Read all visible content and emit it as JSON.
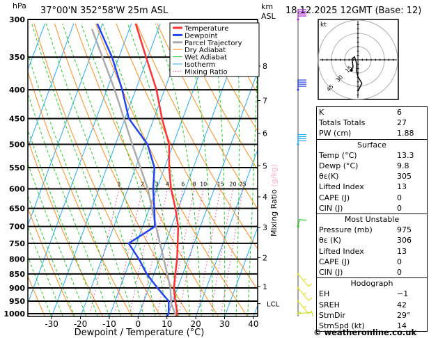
{
  "header": {
    "pressure_unit": "hPa",
    "location": "37°00'N  352°58'W  25m  ASL",
    "km_label": "km",
    "asl_label": "ASL",
    "datetime": "18.12.2025  12GMT  (Base: 12)"
  },
  "chart_data": {
    "type": "skew-t",
    "xlabel": "Dewpoint / Temperature (°C)",
    "ylabel_right_a": "Mixing Ratio",
    "ylabel_right_b": "(g/kg)",
    "xlim": [
      -40,
      40
    ],
    "ylim_hpa": [
      1013,
      300
    ],
    "x_ticks": [
      -30,
      -20,
      -10,
      0,
      10,
      20,
      30,
      40
    ],
    "pressure_levels": [
      300,
      350,
      400,
      450,
      500,
      550,
      600,
      650,
      700,
      750,
      800,
      850,
      900,
      950,
      1000
    ],
    "km_ticks": [
      {
        "km": 1,
        "p": 895
      },
      {
        "km": 2,
        "p": 795
      },
      {
        "km": 3,
        "p": 703
      },
      {
        "km": 4,
        "p": 620
      },
      {
        "km": 5,
        "p": 546
      },
      {
        "km": 6,
        "p": 478
      },
      {
        "km": 7,
        "p": 418
      },
      {
        "km": 8,
        "p": 363
      }
    ],
    "lcl": {
      "label": "LCL",
      "p": 960
    },
    "mixing_ratio_labels": [
      1,
      2,
      3,
      4,
      6,
      8,
      10,
      15,
      20,
      25
    ],
    "legend": [
      {
        "name": "Temperature",
        "color": "#ff3333",
        "width": 3
      },
      {
        "name": "Dewpoint",
        "color": "#2244ee",
        "width": 3
      },
      {
        "name": "Parcel Trajectory",
        "color": "#aaaaaa",
        "width": 3
      },
      {
        "name": "Dry Adiabat",
        "color": "#ff8c1a",
        "width": 1
      },
      {
        "name": "Wet Adiabat",
        "color": "#22cc22",
        "width": 1
      },
      {
        "name": "Isotherm",
        "color": "#22aaff",
        "width": 1
      },
      {
        "name": "Mixing Ratio",
        "color": "#ff3399",
        "width": 1,
        "dotted": true
      }
    ],
    "temperature": {
      "p": [
        1013,
        1000,
        950,
        900,
        850,
        800,
        750,
        700,
        650,
        600,
        550,
        500,
        450,
        400,
        350,
        300
      ],
      "t": [
        13.3,
        13.2,
        10.9,
        8.7,
        7.4,
        6.1,
        4.3,
        2.3,
        -1.0,
        -5.0,
        -8.4,
        -11.4,
        -17.2,
        -22.8,
        -30.6,
        -39.5
      ]
    },
    "dewpoint": {
      "p": [
        1013,
        1000,
        950,
        900,
        850,
        800,
        750,
        700,
        650,
        600,
        550,
        500,
        450,
        400,
        350,
        300
      ],
      "t": [
        9.8,
        10.2,
        8.6,
        3.0,
        -2.5,
        -7.1,
        -12.7,
        -5.8,
        -8.3,
        -11.2,
        -13.5,
        -18.9,
        -28.7,
        -34.7,
        -42.4,
        -53.0
      ]
    },
    "parcel": {
      "p": [
        1013,
        960,
        900,
        800,
        700,
        600,
        500,
        400,
        312
      ],
      "t": [
        13.3,
        9.8,
        7.5,
        1.5,
        -5.4,
        -13.1,
        -24.2,
        -37.3,
        -53.0
      ]
    },
    "wind_barbs": [
      {
        "p": 300,
        "color": "#aa22cc"
      },
      {
        "p": 400,
        "color": "#2244ee"
      },
      {
        "p": 500,
        "color": "#22aaff"
      },
      {
        "p": 700,
        "color": "#22cc22"
      },
      {
        "p": 850,
        "color": "#e8e030"
      },
      {
        "p": 900,
        "color": "#e8e030"
      },
      {
        "p": 950,
        "color": "#e8e030"
      },
      {
        "p": 1000,
        "color": "#c8e030"
      }
    ],
    "hodograph": {
      "unit_label": "kt",
      "rings_kt": [
        15,
        30,
        45
      ],
      "ring_labels": [
        "15",
        "30",
        "45"
      ],
      "trace_uv": [
        [
          0,
          -35.5
        ],
        [
          4.5,
          -26.8
        ],
        [
          0,
          -19
        ],
        [
          -1.6,
          -12.4
        ],
        [
          -1.3,
          -4.5
        ],
        [
          -3.9,
          3.4
        ],
        [
          -6.6,
          1.3
        ],
        [
          -5.5,
          -8.4
        ],
        [
          -7.4,
          -11.8
        ]
      ]
    }
  },
  "indices": {
    "top": [
      {
        "label": "K",
        "value": "6"
      },
      {
        "label": "Totals Totals",
        "value": "27"
      },
      {
        "label": "PW (cm)",
        "value": "1.88"
      }
    ],
    "surface": {
      "title": "Surface",
      "rows": [
        {
          "label": "Temp (°C)",
          "value": "13.3"
        },
        {
          "label": "Dewp (°C)",
          "value": "9.8"
        },
        {
          "label": "θε(K)",
          "value": "305"
        },
        {
          "label": "Lifted Index",
          "value": "13"
        },
        {
          "label": "CAPE (J)",
          "value": "0"
        },
        {
          "label": "CIN (J)",
          "value": "0"
        }
      ]
    },
    "most_unstable": {
      "title": "Most Unstable",
      "rows": [
        {
          "label": "Pressure (mb)",
          "value": "975"
        },
        {
          "label": "θε (K)",
          "value": "306"
        },
        {
          "label": "Lifted Index",
          "value": "13"
        },
        {
          "label": "CAPE (J)",
          "value": "0"
        },
        {
          "label": "CIN (J)",
          "value": "0"
        }
      ]
    },
    "hodograph": {
      "title": "Hodograph",
      "rows": [
        {
          "label": "EH",
          "value": "−1"
        },
        {
          "label": "SREH",
          "value": "42"
        },
        {
          "label": "StmDir",
          "value": "29°"
        },
        {
          "label": "StmSpd (kt)",
          "value": "14"
        }
      ]
    }
  },
  "footer": {
    "copyright": "© weatheronline.co.uk"
  }
}
